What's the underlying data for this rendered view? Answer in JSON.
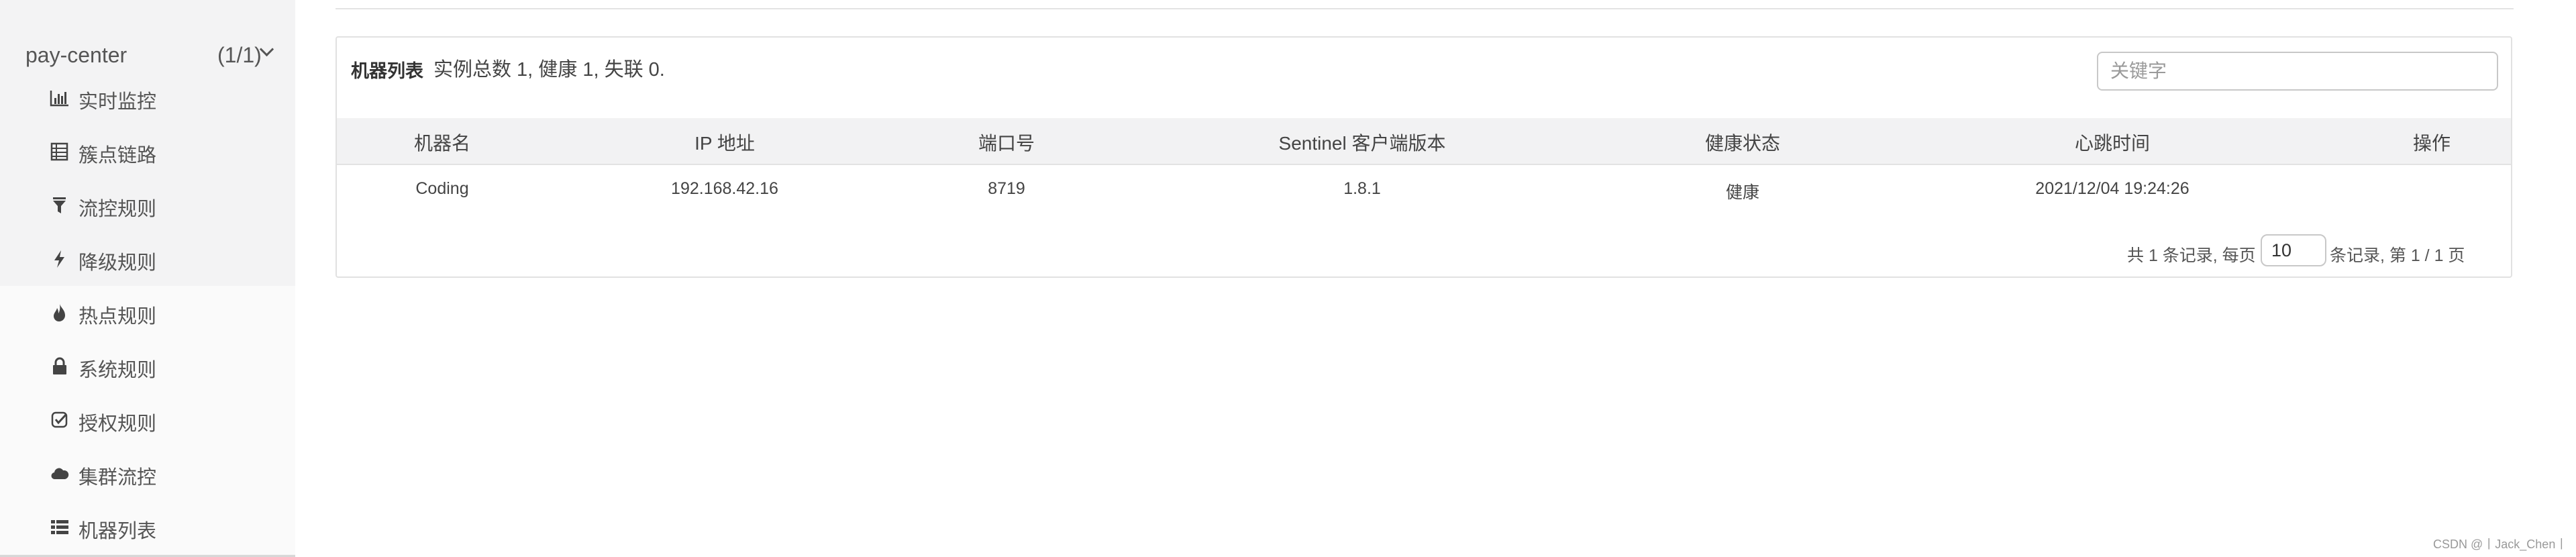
{
  "sidebar": {
    "app_name": "pay-center",
    "app_count": "(1/1)",
    "items": [
      {
        "label": "实时监控",
        "icon": "bar-chart-icon"
      },
      {
        "label": "簇点链路",
        "icon": "table-icon"
      },
      {
        "label": "流控规则",
        "icon": "filter-icon"
      },
      {
        "label": "降级规则",
        "icon": "bolt-icon"
      },
      {
        "label": "热点规则",
        "icon": "fire-icon"
      },
      {
        "label": "系统规则",
        "icon": "lock-icon"
      },
      {
        "label": "授权规则",
        "icon": "check-square-icon"
      },
      {
        "label": "集群流控",
        "icon": "cloud-icon"
      },
      {
        "label": "机器列表",
        "icon": "list-icon"
      }
    ]
  },
  "panel": {
    "title": "机器列表",
    "summary": "实例总数 1, 健康 1, 失联 0.",
    "search_placeholder": "关键字"
  },
  "table": {
    "headers": [
      "机器名",
      "IP 地址",
      "端口号",
      "Sentinel 客户端版本",
      "健康状态",
      "心跳时间",
      "操作"
    ],
    "rows": [
      [
        "Coding",
        "192.168.42.16",
        "8719",
        "1.8.1",
        "健康",
        "2021/12/04 19:24:26",
        ""
      ]
    ]
  },
  "pagination": {
    "prefix": "共 1 条记录, 每页",
    "page_size": "10",
    "suffix": "条记录, 第 1 / 1 页"
  },
  "watermark": "CSDN @丨Jack_Chen丨"
}
